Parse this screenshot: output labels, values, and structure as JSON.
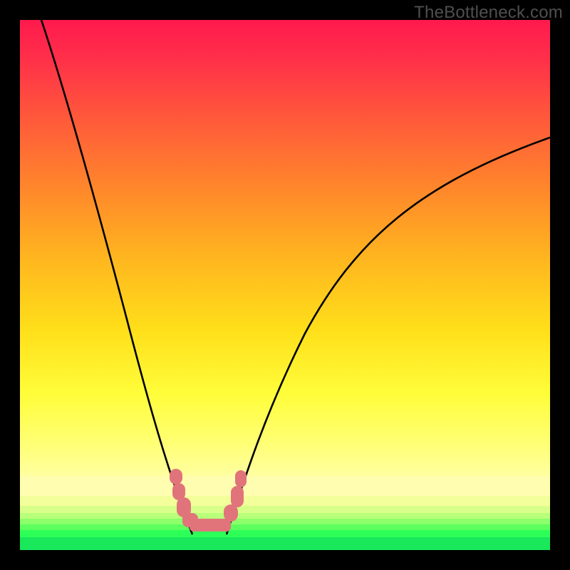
{
  "watermark": "TheBottleneck.com",
  "colors": {
    "frame": "#000000",
    "curve": "#000000",
    "bumps": "#e0747a",
    "gradient_top": "#ff1a4d",
    "gradient_bottom": "#18e85a",
    "watermark_text": "#4f4f4f"
  },
  "chart_data": {
    "type": "line",
    "title": "",
    "xlabel": "",
    "ylabel": "",
    "xlim": [
      0,
      100
    ],
    "ylim": [
      0,
      100
    ],
    "grid": false,
    "legend": false,
    "background": "vertical-gradient red→orange→yellow→green",
    "notes": "Axes are unlabeled; values are visual estimates in percent of plot area, origin bottom-left.",
    "series": [
      {
        "name": "curve-left",
        "x": [
          4,
          8,
          12,
          16,
          20,
          24,
          27,
          29,
          31,
          32.5
        ],
        "y": [
          100,
          88,
          74,
          58,
          42,
          27,
          15,
          8,
          4,
          2.5
        ]
      },
      {
        "name": "curve-right",
        "x": [
          39,
          41,
          44,
          48,
          54,
          62,
          72,
          84,
          100
        ],
        "y": [
          2.5,
          6,
          14,
          26,
          40,
          53,
          64,
          72,
          78
        ]
      }
    ],
    "markers": {
      "name": "valley-bumps",
      "color": "#e0747a",
      "points_x": [
        29,
        30,
        31,
        32.5,
        36,
        39,
        40,
        41
      ],
      "points_y": [
        14,
        11,
        8,
        5,
        4,
        6,
        10,
        14
      ]
    }
  }
}
